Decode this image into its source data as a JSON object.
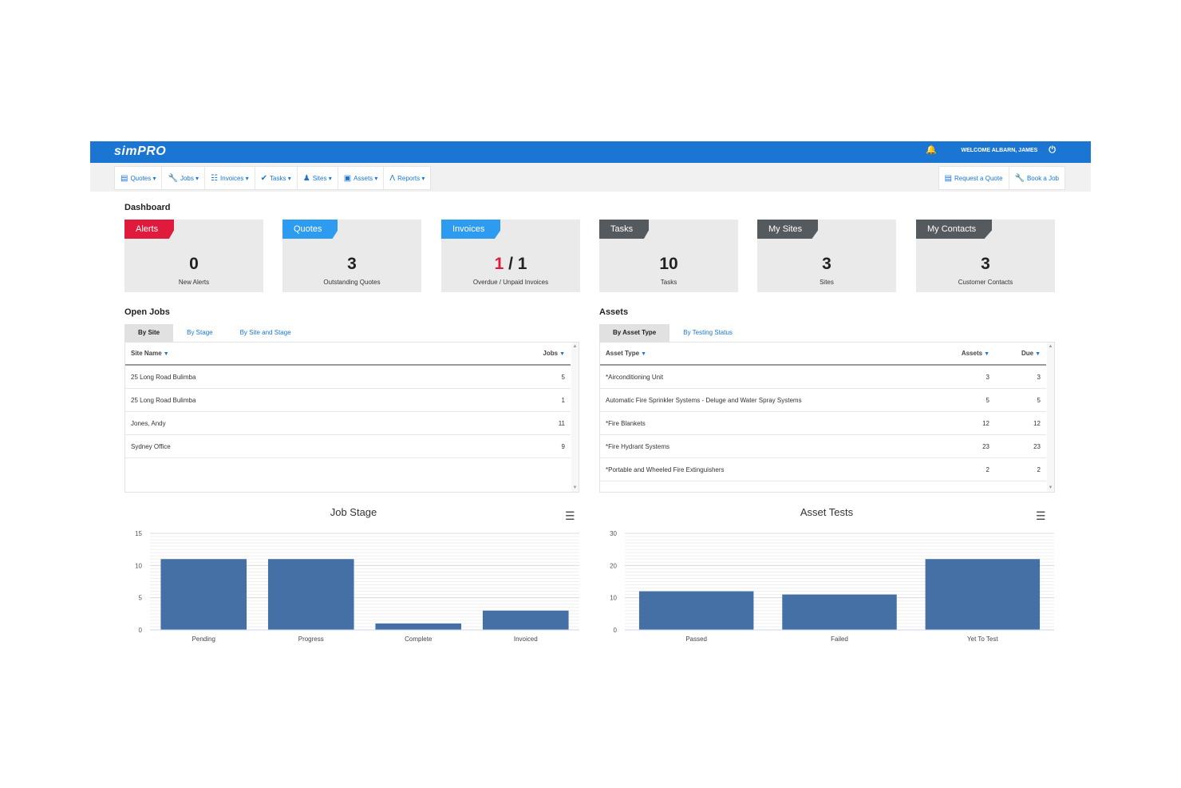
{
  "app": {
    "logo": "simPRO",
    "welcome": "WELCOME ALBARN, JAMES"
  },
  "nav": {
    "items": [
      {
        "label": "Quotes ▾",
        "icon": "document-icon"
      },
      {
        "label": "Jobs ▾",
        "icon": "wrench-icon"
      },
      {
        "label": "Invoices ▾",
        "icon": "invoice-icon"
      },
      {
        "label": "Tasks ▾",
        "icon": "check-circle-icon"
      },
      {
        "label": "Sites ▾",
        "icon": "site-user-icon"
      },
      {
        "label": "Assets ▾",
        "icon": "cube-icon"
      },
      {
        "label": "Reports ▾",
        "icon": "chart-icon"
      }
    ],
    "request_quote": "Request a Quote",
    "book_job": "Book a Job"
  },
  "dashboard": {
    "title": "Dashboard",
    "cards": [
      {
        "tag": "Alerts",
        "value": "0",
        "label": "New Alerts",
        "color": "#e01a3c"
      },
      {
        "tag": "Quotes",
        "value": "3",
        "label": "Outstanding Quotes",
        "color": "#2d9cf0"
      },
      {
        "tag": "Invoices",
        "value_red": "1",
        "value_rest": " / 1",
        "label": "Overdue / Unpaid Invoices",
        "color": "#2d9cf0"
      },
      {
        "tag": "Tasks",
        "value": "10",
        "label": "Tasks",
        "color": "#555a5f"
      },
      {
        "tag": "My Sites",
        "value": "3",
        "label": "Sites",
        "color": "#555a5f"
      },
      {
        "tag": "My Contacts",
        "value": "3",
        "label": "Customer Contacts",
        "color": "#555a5f"
      }
    ]
  },
  "open_jobs": {
    "title": "Open Jobs",
    "tabs": [
      "By Site",
      "By Stage",
      "By Site and Stage"
    ],
    "columns": [
      "Site Name",
      "Jobs"
    ],
    "rows": [
      [
        "25 Long Road Bulimba",
        "5"
      ],
      [
        "25 Long Road Bulimba",
        "1"
      ],
      [
        "Jones, Andy",
        "11"
      ],
      [
        "Sydney Office",
        "9"
      ]
    ]
  },
  "assets": {
    "title": "Assets",
    "tabs": [
      "By Asset Type",
      "By Testing Status"
    ],
    "columns": [
      "Asset Type",
      "Assets",
      "Due"
    ],
    "rows": [
      [
        "*Airconditioning Unit",
        "3",
        "3"
      ],
      [
        "Automatic Fire Sprinkler Systems - Deluge and Water Spray Systems",
        "5",
        "5"
      ],
      [
        "*Fire Blankets",
        "12",
        "12"
      ],
      [
        "*Fire Hydrant Systems",
        "23",
        "23"
      ],
      [
        "*Portable and Wheeled Fire Extinguishers",
        "2",
        "2"
      ]
    ]
  },
  "chart_data": [
    {
      "type": "bar",
      "title": "Job Stage",
      "categories": [
        "Pending",
        "Progress",
        "Complete",
        "Invoiced"
      ],
      "values": [
        11,
        11,
        1,
        3
      ],
      "ylim": [
        0,
        15
      ],
      "yticks": [
        "0",
        "5",
        "10",
        "15"
      ],
      "color": "#4470a5"
    },
    {
      "type": "bar",
      "title": "Asset Tests",
      "categories": [
        "Passed",
        "Failed",
        "Yet To Test"
      ],
      "values": [
        12,
        11,
        22
      ],
      "ylim": [
        0,
        30
      ],
      "yticks": [
        "0",
        "10",
        "20",
        "30"
      ],
      "color": "#4470a5"
    }
  ]
}
